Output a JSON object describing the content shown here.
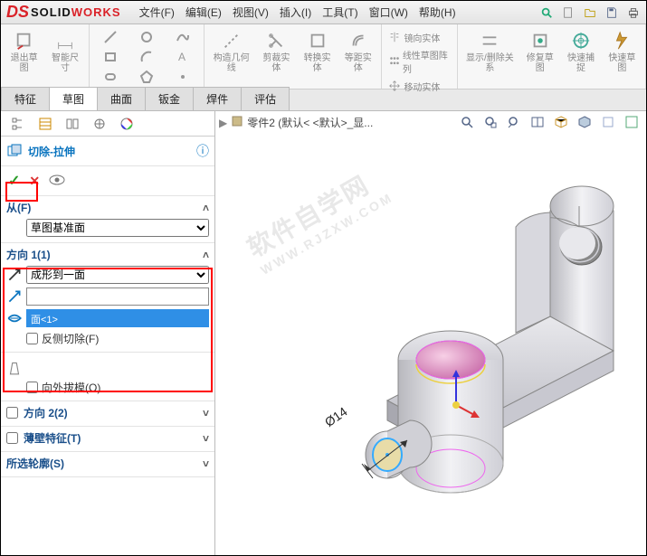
{
  "app": {
    "brand_prefix": "SOLID",
    "brand_suffix": "WORKS"
  },
  "menu": [
    "文件(F)",
    "编辑(E)",
    "视图(V)",
    "插入(I)",
    "工具(T)",
    "窗口(W)",
    "帮助(H)"
  ],
  "ribbon": {
    "g1": {
      "a": "退出草图",
      "b": "智能尺寸"
    },
    "g2": {
      "a": "构造几何线",
      "b": "剪裁实体",
      "c": "转换实体",
      "d": "等距实体",
      "e": "镜向实体",
      "f": "线性草图阵列",
      "g": "移动实体"
    },
    "g3": {
      "a": "显示/删除关系",
      "b": "修复草图",
      "c": "快速捕捉",
      "d": "快速草图"
    }
  },
  "tabs": [
    "特征",
    "草图",
    "曲面",
    "钣金",
    "焊件",
    "评估"
  ],
  "activeTab": 1,
  "crumb": {
    "doc": "零件2  (默认< <默认>_显..."
  },
  "pm": {
    "title": "切除-拉伸",
    "from": {
      "head": "从(F)",
      "combo": "草图基准面"
    },
    "dir1": {
      "head": "方向 1(1)",
      "combo": "成形到一面",
      "sel": "面<1>",
      "flip_chk": "反侧切除(F)"
    },
    "draft_chk": "向外拔模(O)",
    "dir2": "方向 2(2)",
    "thin": "薄壁特征(T)",
    "contour": "所选轮廓(S)"
  },
  "dim": "Ø14",
  "watermark": {
    "line1": "软件自学网",
    "line2": "WWW.RJZXW.COM"
  }
}
